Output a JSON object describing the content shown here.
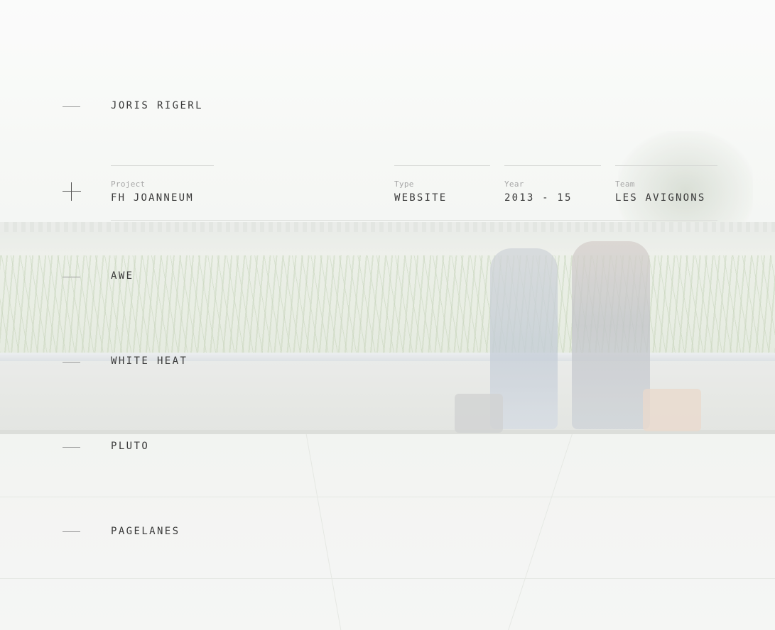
{
  "projects": [
    {
      "name": "JORIS RIGERL",
      "expanded": false
    },
    {
      "name": "FH JOANNEUM",
      "expanded": true
    },
    {
      "name": "AWE",
      "expanded": false
    },
    {
      "name": "WHITE HEAT",
      "expanded": false
    },
    {
      "name": "PLUTO",
      "expanded": false
    },
    {
      "name": "PAGELANES",
      "expanded": false
    }
  ],
  "detail": {
    "project_label": "Project",
    "project_value": "FH JOANNEUM",
    "type_label": "Type",
    "type_value": "WEBSITE",
    "year_label": "Year",
    "year_value": "2013 - 15",
    "team_label": "Team",
    "team_value": "LES AVIGNONS"
  },
  "icons": {
    "collapsed": "dash-icon",
    "expanded": "plus-icon"
  },
  "colors": {
    "text": "#3a3a3a",
    "label": "#a6a6a6",
    "line": "#d6d8d5"
  }
}
